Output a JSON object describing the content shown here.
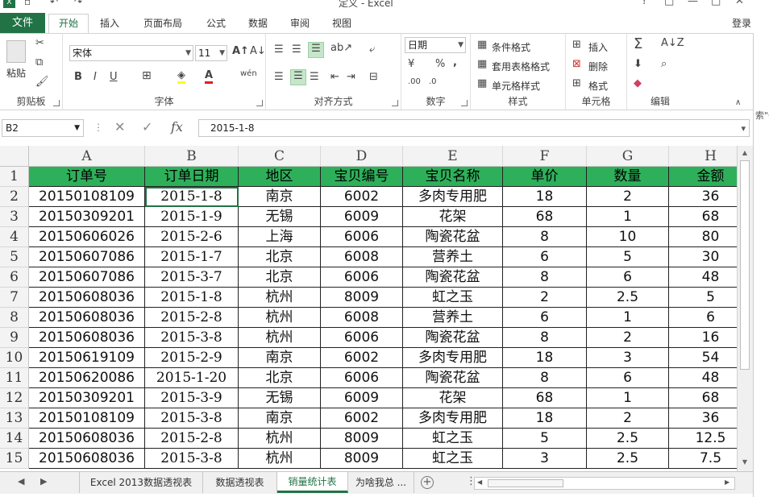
{
  "window": {
    "title": "定义 - Excel",
    "app_icon": "X",
    "controls": [
      "?",
      "□",
      "—",
      "□",
      "✕"
    ]
  },
  "ribbon_tabs": {
    "file": "文件",
    "tabs": [
      "开始",
      "插入",
      "页面布局",
      "公式",
      "数据",
      "审阅",
      "视图"
    ],
    "active": "开始",
    "login": "登录"
  },
  "ribbon": {
    "clipboard": {
      "label": "剪贴板",
      "paste": "粘贴"
    },
    "font": {
      "label": "字体",
      "name": "宋体",
      "size": "11",
      "bold": "B",
      "italic": "I",
      "underline": "U",
      "wen": "wén"
    },
    "alignment": {
      "label": "对齐方式"
    },
    "number": {
      "label": "数字",
      "format": "日期",
      "percent": "%",
      "comma": ","
    },
    "styles": {
      "label": "样式",
      "cond_format": "条件格式",
      "table_format": "套用表格格式",
      "cell_style": "单元格样式"
    },
    "cells": {
      "label": "单元格",
      "insert": "插入",
      "delete": "删除",
      "format": "格式"
    },
    "editing": {
      "label": "编辑"
    },
    "right_fragment": "索\"0"
  },
  "formula_bar": {
    "name_box": "B2",
    "fx": "fx",
    "value": "2015-1-8"
  },
  "sheet": {
    "columns": [
      "A",
      "B",
      "C",
      "D",
      "E",
      "F",
      "G",
      "H"
    ],
    "row_numbers": [
      "1",
      "2",
      "3",
      "4",
      "5",
      "6",
      "7",
      "8",
      "9",
      "10",
      "11",
      "12",
      "13",
      "14",
      "15"
    ],
    "headers": [
      "订单号",
      "订单日期",
      "地区",
      "宝贝编号",
      "宝贝名称",
      "单价",
      "数量",
      "金额"
    ],
    "rows": [
      [
        "20150108109",
        "2015-1-8",
        "南京",
        "6002",
        "多肉专用肥",
        "18",
        "2",
        "36"
      ],
      [
        "20150309201",
        "2015-1-9",
        "无锡",
        "6009",
        "花架",
        "68",
        "1",
        "68"
      ],
      [
        "20150606026",
        "2015-2-6",
        "上海",
        "6006",
        "陶瓷花盆",
        "8",
        "10",
        "80"
      ],
      [
        "20150607086",
        "2015-1-7",
        "北京",
        "6008",
        "营养土",
        "6",
        "5",
        "30"
      ],
      [
        "20150607086",
        "2015-3-7",
        "北京",
        "6006",
        "陶瓷花盆",
        "8",
        "6",
        "48"
      ],
      [
        "20150608036",
        "2015-1-8",
        "杭州",
        "8009",
        "虹之玉",
        "2",
        "2.5",
        "5"
      ],
      [
        "20150608036",
        "2015-2-8",
        "杭州",
        "6008",
        "营养土",
        "6",
        "1",
        "6"
      ],
      [
        "20150608036",
        "2015-3-8",
        "杭州",
        "6006",
        "陶瓷花盆",
        "8",
        "2",
        "16"
      ],
      [
        "20150619109",
        "2015-2-9",
        "南京",
        "6002",
        "多肉专用肥",
        "18",
        "3",
        "54"
      ],
      [
        "20150620086",
        "2015-1-20",
        "北京",
        "6006",
        "陶瓷花盆",
        "8",
        "6",
        "48"
      ],
      [
        "20150309201",
        "2015-3-9",
        "无锡",
        "6009",
        "花架",
        "68",
        "1",
        "68"
      ],
      [
        "20150108109",
        "2015-3-8",
        "南京",
        "6002",
        "多肉专用肥",
        "18",
        "2",
        "36"
      ],
      [
        "20150608036",
        "2015-2-8",
        "杭州",
        "8009",
        "虹之玉",
        "5",
        "2.5",
        "12.5"
      ],
      [
        "20150608036",
        "2015-3-8",
        "杭州",
        "8009",
        "虹之玉",
        "3",
        "2.5",
        "7.5"
      ]
    ],
    "header_color": "#2eb05a",
    "selected_cell": "B2"
  },
  "sheet_tabs": {
    "tabs": [
      "Excel 2013数据透视表",
      "数据透视表",
      "销量统计表",
      "为啥我总 ..."
    ],
    "active": "销量统计表",
    "add": "+"
  }
}
